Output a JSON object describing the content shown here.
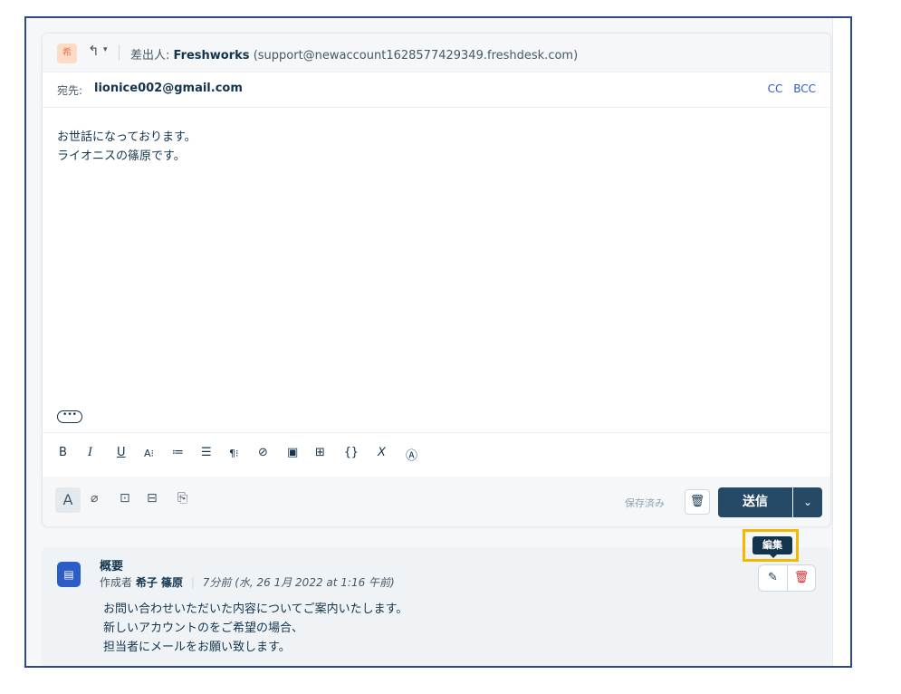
{
  "composer": {
    "avatar_letter": "希",
    "from_label": "差出人:",
    "from_name": "Freshworks",
    "from_email": "(support@newaccount1628577429349.freshdesk.com)",
    "to_label": "宛先:",
    "to_address": "lionice002@gmail.com",
    "cc_label": "CC",
    "bcc_label": "BCC",
    "body_lines": [
      "お世話になっております。",
      "ライオニスの篠原です。"
    ],
    "saved_label": "保存済み",
    "send_label": "送信"
  },
  "toolbar": {
    "icons": [
      "bold-icon",
      "italic-icon",
      "underline-icon",
      "font-size-icon",
      "ordered-list-icon",
      "bullet-list-icon",
      "paragraph-icon",
      "link-icon",
      "image-icon",
      "table-icon",
      "code-icon",
      "clear-format-icon",
      "spellcheck-icon"
    ]
  },
  "footer": {
    "icons": [
      "text-format-icon",
      "attachment-icon",
      "canned-response-icon",
      "solution-article-icon",
      "template-icon"
    ]
  },
  "note": {
    "title": "概要",
    "author_prefix": "作成者",
    "author": "希子 篠原",
    "time_ago": "7分前",
    "timestamp": "(水, 26 1月 2022 at 1:16 午前)",
    "body_lines": [
      "お問い合わせいただいた内容についてご案内いたします。",
      "新しいアカウントのをご希望の場合、",
      "担当者にメールをお願い致します。"
    ]
  },
  "tooltip": {
    "text": "編集"
  }
}
